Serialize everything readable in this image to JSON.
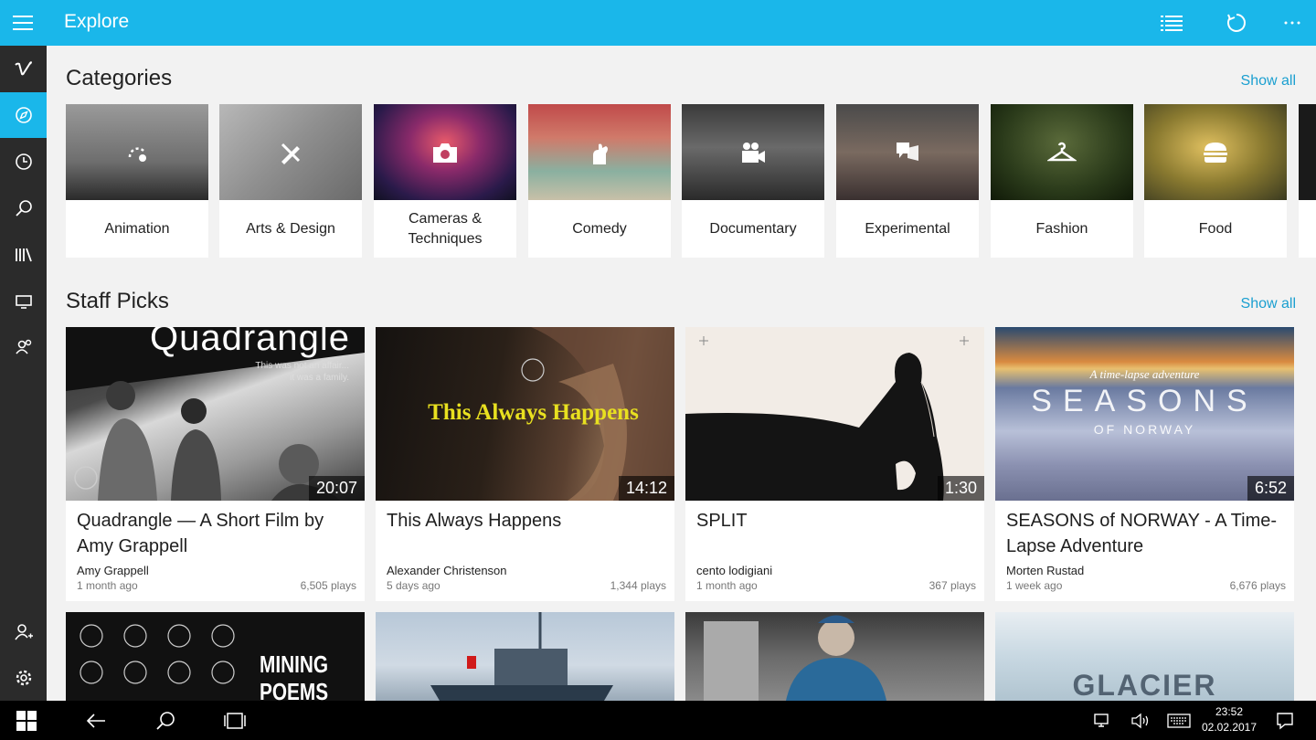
{
  "app": {
    "title": "Explore"
  },
  "categories_section": {
    "title": "Categories",
    "show_all": "Show all",
    "items": [
      {
        "label": "Animation",
        "icon": "animation-icon"
      },
      {
        "label": "Arts & Design",
        "icon": "arts-design-icon"
      },
      {
        "label": "Cameras & Techniques",
        "icon": "camera-icon"
      },
      {
        "label": "Comedy",
        "icon": "comedy-icon"
      },
      {
        "label": "Documentary",
        "icon": "video-camera-icon"
      },
      {
        "label": "Experimental",
        "icon": "experimental-icon"
      },
      {
        "label": "Fashion",
        "icon": "hanger-icon"
      },
      {
        "label": "Food",
        "icon": "burger-icon"
      }
    ]
  },
  "staff_picks": {
    "title": "Staff Picks",
    "show_all": "Show all",
    "videos": [
      {
        "title": "Quadrangle — A Short Film by Amy Grappell",
        "author": "Amy Grappell",
        "time": "1 month ago",
        "plays": "6,505 plays",
        "duration": "20:07",
        "thumb_text": "Quadrangle",
        "thumb_sub": "This was not an affair... it was a family."
      },
      {
        "title": "This Always Happens",
        "author": "Alexander Christenson",
        "time": "5 days ago",
        "plays": "1,344 plays",
        "duration": "14:12",
        "thumb_text": "This Always Happens"
      },
      {
        "title": "SPLIT",
        "author": "cento lodigiani",
        "time": "1 month ago",
        "plays": "367 plays",
        "duration": "1:30"
      },
      {
        "title": "SEASONS of NORWAY - A Time-Lapse Adventure",
        "author": "Morten Rustad",
        "time": "1 week ago",
        "plays": "6,676 plays",
        "duration": "6:52",
        "thumb_text": "SEASONS",
        "thumb_sub": "OF NORWAY",
        "thumb_script": "A time-lapse adventure"
      }
    ],
    "row2": [
      {
        "thumb_text": "MINING POEMS"
      },
      {
        "thumb_text": ""
      },
      {
        "thumb_text": ""
      },
      {
        "thumb_text": "GLACIER"
      }
    ]
  },
  "taskbar": {
    "time": "23:52",
    "date": "02.02.2017"
  },
  "colors": {
    "accent": "#1ab7ea",
    "sidebar": "#2b2b2b",
    "link": "#1a9fd0"
  }
}
